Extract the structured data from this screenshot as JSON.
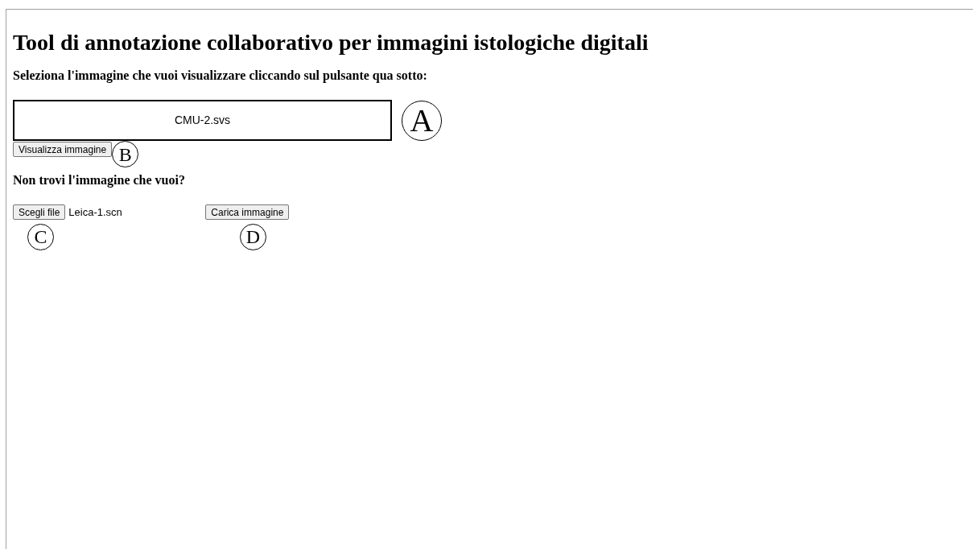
{
  "title": "Tool di annotazione collaborativo per immagini istologiche digitali",
  "instruction": "Seleziona l'immagine che vuoi visualizzare cliccando sul pulsante qua sotto:",
  "image_select": {
    "value": "CMU-2.svs",
    "callout": "A"
  },
  "view_button": {
    "label": "Visualizza immagine",
    "callout": "B"
  },
  "upload_heading": "Non trovi l'immagine che vuoi?",
  "file_chooser": {
    "button": "Scegli file",
    "file_name": "Leica-1.scn",
    "callout": "C"
  },
  "upload_button": {
    "label": "Carica immagine",
    "callout": "D"
  }
}
